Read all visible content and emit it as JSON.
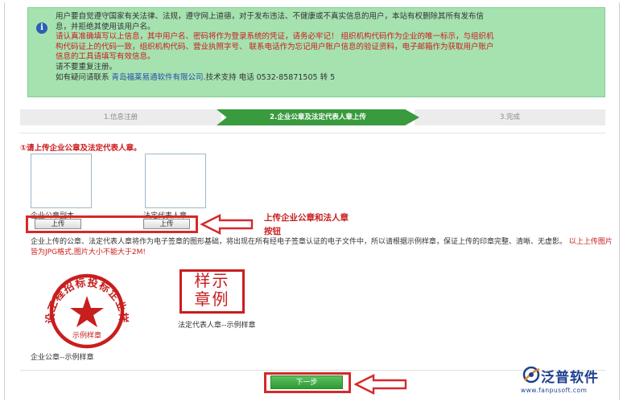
{
  "notice": {
    "lines": [
      {
        "text": "用户要自觉遵守国家有关法律、法规，遵守网上道德，对于发布违法、不健康或不真实信息的用户，本站有权删除其所有发布信",
        "color": "black"
      },
      {
        "text": "息，并拒绝其使用该用户名。",
        "color": "black"
      },
      {
        "text": "请认真准确填写以上信息，其中用户名、密码将作为登录系统的凭证，请务必牢记！ 组织机构代码作为企业的唯一标示，与组织机",
        "color": "red"
      },
      {
        "text": "构代码证上的代码一致，组织机构代码、营业执照字号、 联系电话作为忘记用户账户信息的验证资料，电子邮箱作为获取用户账户",
        "color": "red"
      },
      {
        "text": "信息的工具请填写有效信息。",
        "color": "red"
      },
      {
        "text": "请不要重复注册。",
        "color": "black"
      }
    ],
    "contact_prefix": "如有疑问请联系 ",
    "contact_company": "青岛福莱易通软件有限公司",
    "contact_suffix": ".技术支持 电话 0532-85871505 转 5"
  },
  "steps": {
    "step1": "1.信息注册",
    "step2": "2.企业公章及法定代表人章上传",
    "step3": "3.完成"
  },
  "section_title": "①请上传企业公章及法定代表人章。",
  "uploads": {
    "label1": "企业公章副本",
    "label2": "法定代表人章",
    "button1": "上传",
    "button2": "上传"
  },
  "callout": {
    "line1": "上传企业公章和法人章",
    "line2": "按钮"
  },
  "description": {
    "main": "企业上传的公章、法定代表人章将作为电子签章的图形基础，将出现在所有经电子签章认证的电子文件中，所以请根据示例样章，保证上传的印章完整、清晰、无虚影。",
    "red": "以上上传图片皆为JPG格式,图片大小不能大于2M!"
  },
  "samples": {
    "seal_ring_text": "建设工程招标投标企业样章",
    "seal_bottom_text": "示例样章",
    "seal_label": "企业公章--示例样章",
    "person_stamp_line1": "样示",
    "person_stamp_line2": "章例",
    "person_label": "法定代表人章--示例样章"
  },
  "next_button": "下一步",
  "logo": {
    "name": "泛普软件",
    "url": "www.fanpusoft.com"
  },
  "colors": {
    "notice_bg": "#a5e2b0",
    "active_step": "#3a9a3e",
    "alert_red": "#cc1a1a",
    "brand_blue": "#1e3f90"
  }
}
